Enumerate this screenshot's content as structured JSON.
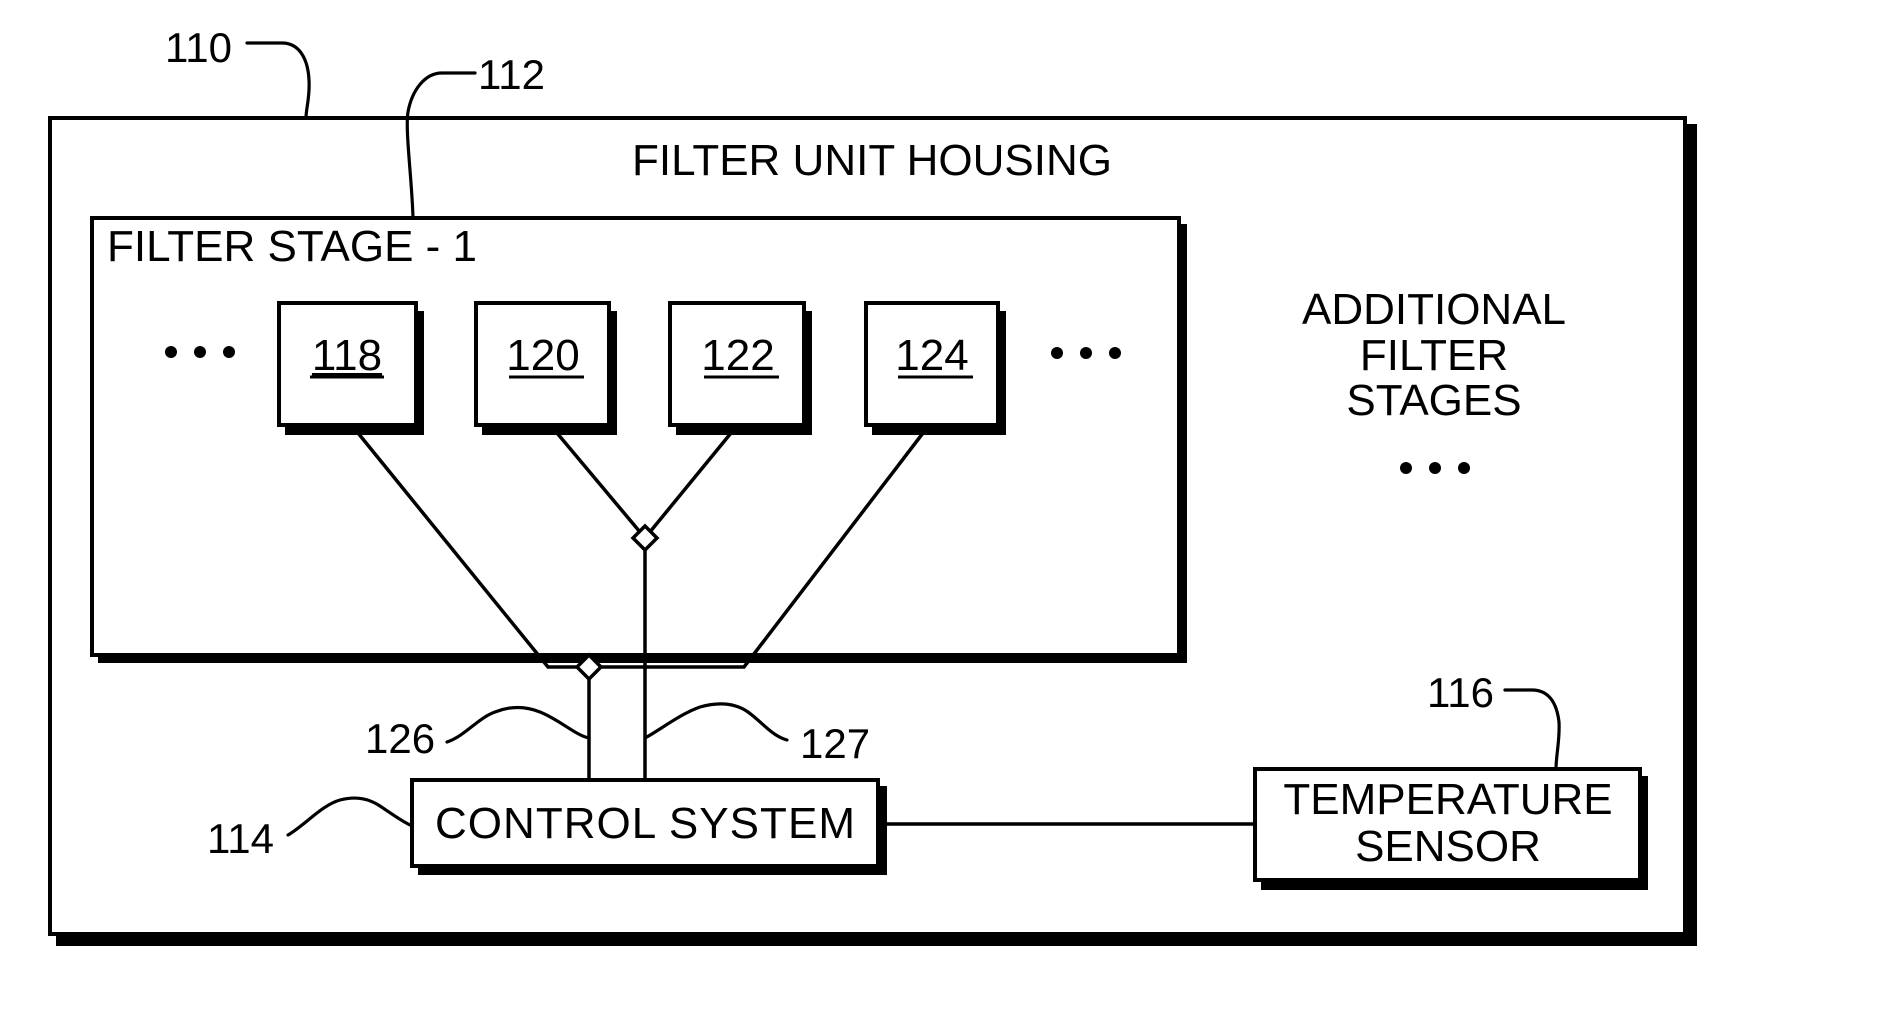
{
  "diagram": {
    "housing": {
      "ref": "110",
      "title": "FILTER UNIT HOUSING"
    },
    "filter_stage": {
      "ref": "112",
      "title": "FILTER STAGE - 1",
      "elements": [
        {
          "ref": "118"
        },
        {
          "ref": "120"
        },
        {
          "ref": "122"
        },
        {
          "ref": "124"
        }
      ],
      "ellipsis_icon": "ellipsis-horizontal"
    },
    "additional_stages": {
      "lines": [
        "ADDITIONAL",
        "FILTER",
        "STAGES"
      ],
      "ellipsis_icon": "ellipsis-horizontal"
    },
    "control_system": {
      "ref": "114",
      "label": "CONTROL SYSTEM"
    },
    "temperature_sensor": {
      "ref": "116",
      "lines": [
        "TEMPERATURE",
        "SENSOR"
      ]
    },
    "connections": [
      {
        "ref": "126",
        "from": "control_system",
        "to": "filter elements 118 & 124"
      },
      {
        "ref": "127",
        "from": "control_system",
        "to": "filter elements 120 & 122"
      }
    ]
  }
}
